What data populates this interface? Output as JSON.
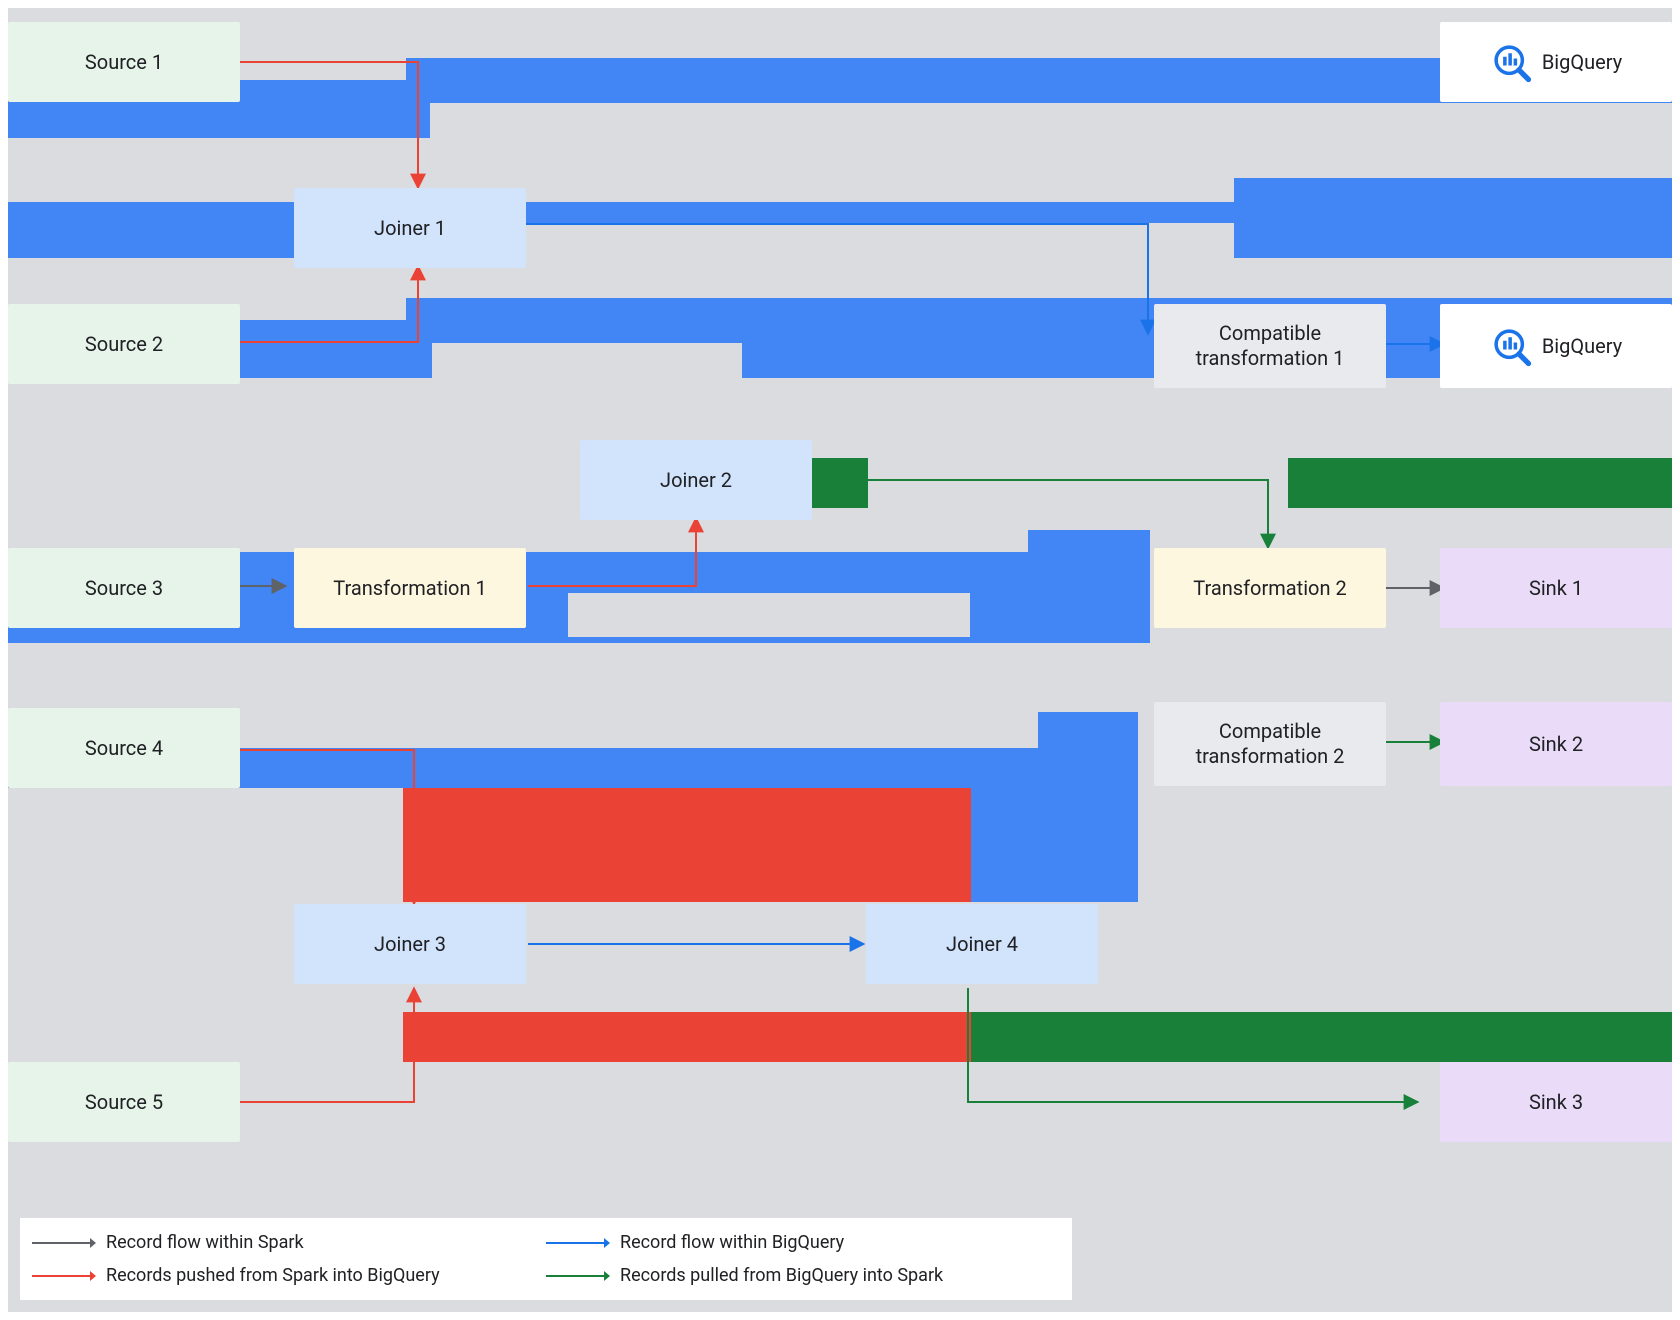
{
  "nodes": {
    "source1": "Source 1",
    "source2": "Source 2",
    "source3": "Source 3",
    "source4": "Source 4",
    "source5": "Source 5",
    "joiner1": "Joiner 1",
    "joiner2": "Joiner 2",
    "joiner3": "Joiner 3",
    "joiner4": "Joiner 4",
    "trans1": "Transformation 1",
    "trans2": "Transformation 2",
    "comp1": "Compatible transformation 1",
    "comp2": "Compatible transformation 2",
    "sink1": "Sink 1",
    "sink2": "Sink 2",
    "sink3": "Sink 3",
    "bq": "BigQuery"
  },
  "legend": {
    "within_spark": "Record flow within Spark",
    "within_bq": "Record flow within BigQuery",
    "pushed": "Records pushed from Spark into BigQuery",
    "pulled": "Records pulled from BigQuery into Spark"
  },
  "colors": {
    "blue": "#4285f4",
    "green": "#188038",
    "red": "#ea4335",
    "grey_arrow": "#5f6368",
    "blue_arrow": "#1a73e8",
    "red_arrow": "#ea4335",
    "green_arrow": "#188038"
  }
}
